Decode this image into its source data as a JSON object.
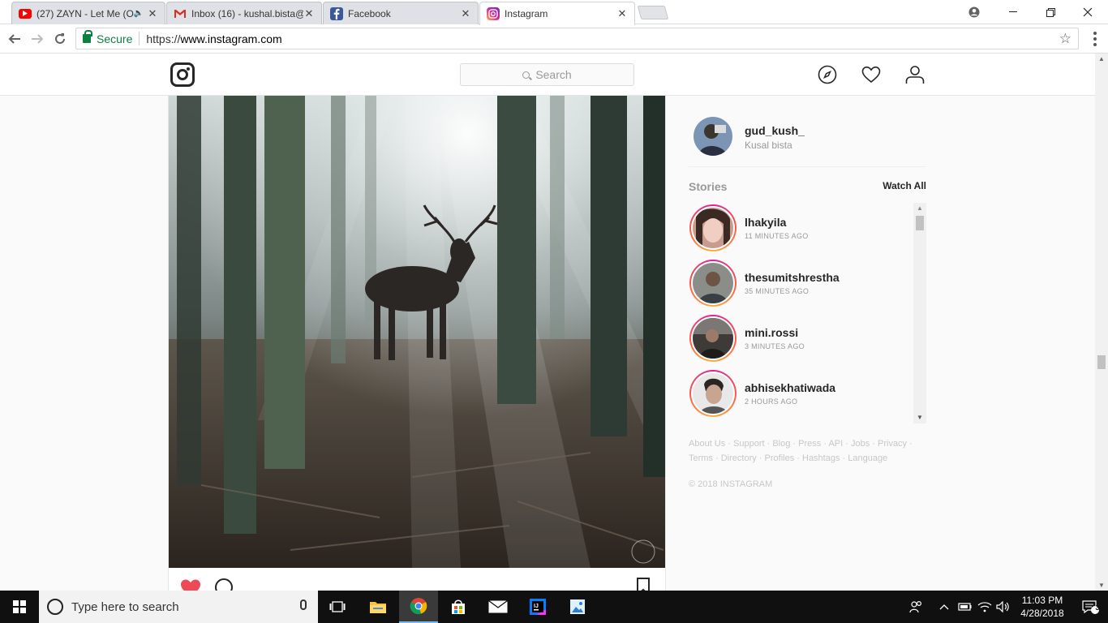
{
  "browser": {
    "tabs": [
      {
        "title": "(27) ZAYN - Let Me (O",
        "icon": "youtube-icon"
      },
      {
        "title": "Inbox (16) - kushal.bista@",
        "icon": "gmail-icon"
      },
      {
        "title": "Facebook",
        "icon": "facebook-icon"
      },
      {
        "title": "Instagram",
        "icon": "instagram-icon"
      }
    ],
    "security_label": "Secure",
    "url_scheme": "https://",
    "url_host": "www.instagram.com"
  },
  "header": {
    "search_placeholder": "Search"
  },
  "profile": {
    "username": "gud_kush_",
    "full_name": "Kusal bista"
  },
  "stories": {
    "label": "Stories",
    "watch_all": "Watch All",
    "items": [
      {
        "username": "lhakyila",
        "time": "11 MINUTES AGO"
      },
      {
        "username": "thesumitshrestha",
        "time": "35 MINUTES AGO"
      },
      {
        "username": "mini.rossi",
        "time": "3 MINUTES AGO"
      },
      {
        "username": "abhisekhatiwada",
        "time": "2 HOURS AGO"
      }
    ]
  },
  "footer": {
    "links": [
      "About Us",
      "Support",
      "Blog",
      "Press",
      "API",
      "Jobs",
      "Privacy",
      "Terms",
      "Directory",
      "Profiles",
      "Hashtags",
      "Language"
    ],
    "copyright": "© 2018 INSTAGRAM"
  },
  "taskbar": {
    "search_placeholder": "Type here to search",
    "time": "11:03 PM",
    "date": "4/28/2018",
    "notification_count": "3"
  },
  "colors": {
    "like_red": "#ed4956",
    "secure_green": "#0b8043",
    "story_ring": "#d6249f"
  }
}
